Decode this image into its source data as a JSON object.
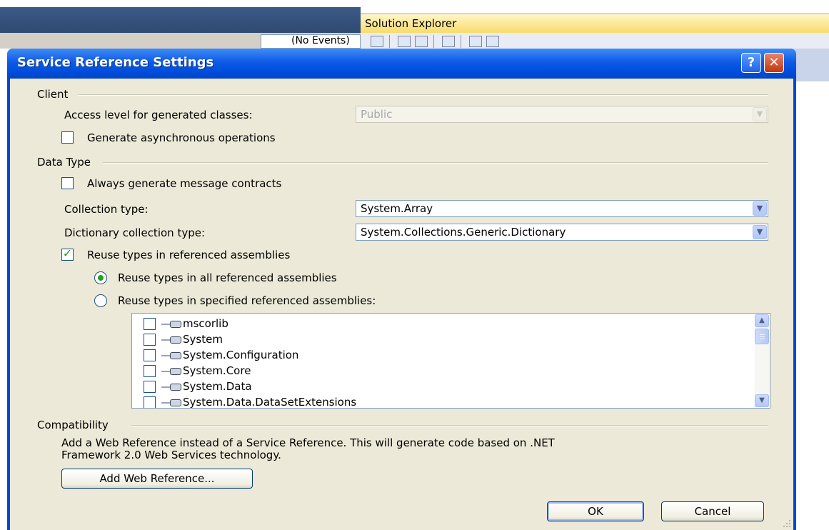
{
  "ide": {
    "combo_text": "(No Events)",
    "solution_explorer_title": "Solution Explorer"
  },
  "dialog": {
    "title": "Service Reference Settings",
    "help_label": "?",
    "close_label": "✕"
  },
  "client_group": {
    "label": "Client",
    "access_label": "Access level for generated classes:",
    "access_value": "Public",
    "async_label": "Generate asynchronous operations",
    "async_checked": false
  },
  "data_type_group": {
    "label": "Data Type",
    "message_contracts_label": "Always generate message contracts",
    "message_contracts_checked": false,
    "collection_type_label": "Collection type:",
    "collection_type_value": "System.Array",
    "dictionary_type_label": "Dictionary collection type:",
    "dictionary_type_value": "System.Collections.Generic.Dictionary",
    "reuse_label": "Reuse types in referenced assemblies",
    "reuse_checked": true,
    "reuse_all_label": "Reuse types in all referenced assemblies",
    "reuse_specified_label": "Reuse types in specified referenced assemblies:",
    "selected_reuse_option": "all",
    "assemblies": [
      "mscorlib",
      "System",
      "System.Configuration",
      "System.Core",
      "System.Data",
      "System.Data.DataSetExtensions"
    ]
  },
  "compatibility_group": {
    "label": "Compatibility",
    "description_line1": "Add a Web Reference instead of a Service Reference. This will generate code based on .NET",
    "description_line2": "Framework 2.0 Web Services technology.",
    "add_web_reference_label": "Add Web Reference..."
  },
  "buttons": {
    "ok_label": "OK",
    "cancel_label": "Cancel"
  },
  "colors": {
    "titlebar": "#0050e0",
    "dialog_face": "#ece9d8",
    "check_mark": "#21a121"
  }
}
